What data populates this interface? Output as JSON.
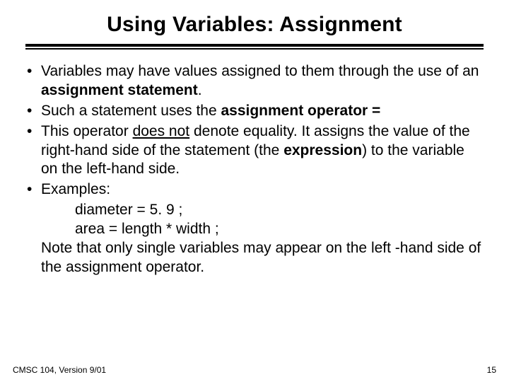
{
  "title": "Using Variables: Assignment",
  "b1": {
    "pre": "Variables may have values assigned to them through the use of an ",
    "bold": "assignment statement",
    "post": "."
  },
  "b2": {
    "pre": "Such a statement uses the ",
    "bold": "assignment operator  ="
  },
  "b3": {
    "pre": "This operator ",
    "ul": "does not",
    "mid": " denote equality.  It assigns the value of the right-hand side of the statement (the ",
    "bold": "expression",
    "post": ") to the variable on the left-hand side."
  },
  "b4": {
    "label": "Examples:"
  },
  "ex1": "diameter = 5. 9 ;",
  "ex2": "area = length * width ;",
  "note": "Note that only single variables may appear on the left -hand side of the assignment operator.",
  "footer": {
    "left": "CMSC 104, Version 9/01",
    "right": "15"
  }
}
